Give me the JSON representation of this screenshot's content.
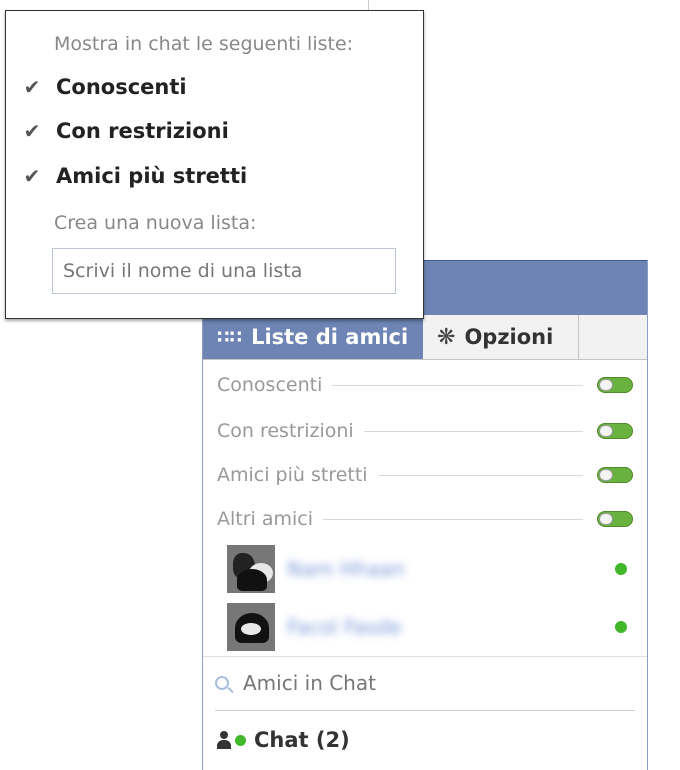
{
  "popup": {
    "header": "Mostra in chat le seguenti liste:",
    "items": [
      {
        "label": "Conoscenti",
        "checked": true
      },
      {
        "label": "Con restrizioni",
        "checked": true
      },
      {
        "label": "Amici più stretti",
        "checked": true
      }
    ],
    "check_icon": "checkmark-icon",
    "new_list_label": "Crea una nuova lista:",
    "new_list_placeholder": "Scrivi il nome di una lista"
  },
  "chat": {
    "tabs": {
      "friends_label": "Liste di amici",
      "friends_icon": "grid-icon",
      "options_label": "Opzioni",
      "options_icon": "gear-icon"
    },
    "lists": [
      {
        "label": "Conoscenti",
        "enabled": true
      },
      {
        "label": "Con restrizioni",
        "enabled": true
      },
      {
        "label": "Amici più stretti",
        "enabled": true
      },
      {
        "label": "Altri amici",
        "enabled": true
      }
    ],
    "friends": [
      {
        "name": "Nam Hhaan",
        "online": true
      },
      {
        "name": "Facol Fasde",
        "online": true
      }
    ],
    "search_placeholder": "Amici in Chat",
    "chat_label": "Chat (2)",
    "colors": {
      "header_blue": "#6d84b4",
      "online_green": "#42b72a",
      "toggle_green": "#6ab23f"
    }
  }
}
